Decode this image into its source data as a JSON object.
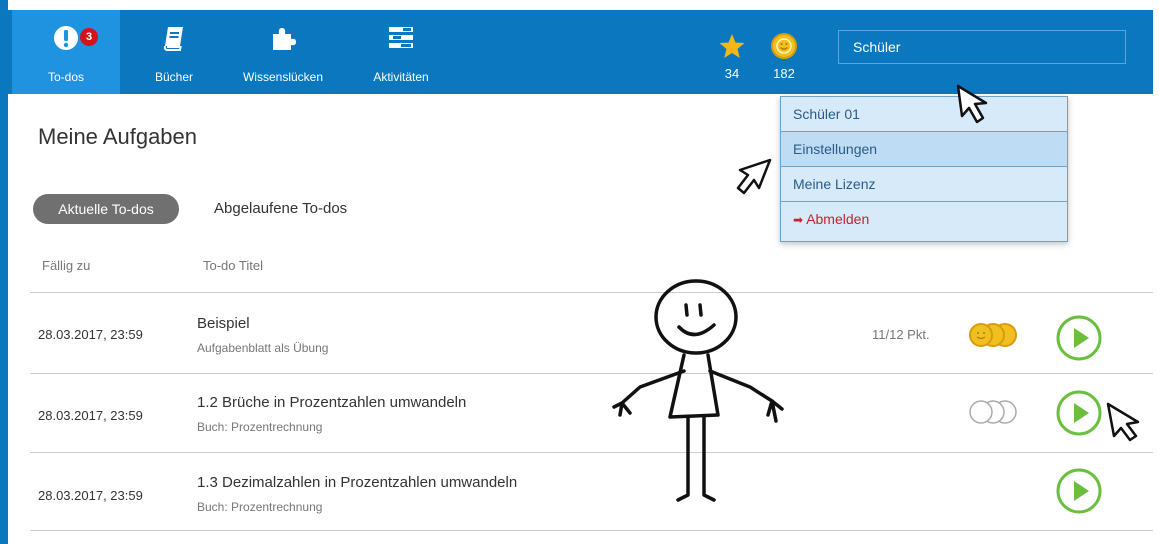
{
  "nav": {
    "items": [
      {
        "label": "To-dos",
        "badge": "3"
      },
      {
        "label": "Bücher"
      },
      {
        "label": "Wissenslücken"
      },
      {
        "label": "Aktivitäten"
      }
    ],
    "stars": "34",
    "coins": "182",
    "user": "Schüler"
  },
  "dropdown": {
    "items": [
      "Schüler 01",
      "Einstellungen",
      "Meine Lizenz",
      "Abmelden"
    ]
  },
  "page": {
    "title": "Meine Aufgaben",
    "tab_current": "Aktuelle To-dos",
    "tab_expired": "Abgelaufene To-dos",
    "col_due": "Fällig zu",
    "col_title": "To-do Titel"
  },
  "rows": [
    {
      "due": "28.03.2017, 23:59",
      "title": "Beispiel",
      "subtitle": "Aufgabenblatt als Übung",
      "points": "11/12 Pkt."
    },
    {
      "due": "28.03.2017, 23:59",
      "title": "1.2 Brüche in Prozentzahlen umwandeln",
      "subtitle": "Buch: Prozentrechnung"
    },
    {
      "due": "28.03.2017, 23:59",
      "title": "1.3 Dezimalzahlen in Prozentzahlen umwandeln",
      "subtitle": "Buch: Prozentrechnung"
    }
  ],
  "colors": {
    "nav": "#0b77be",
    "active": "#1f93e0",
    "badge": "#d0141c",
    "play": "#6abf3d",
    "coin": "#e8b21c"
  }
}
